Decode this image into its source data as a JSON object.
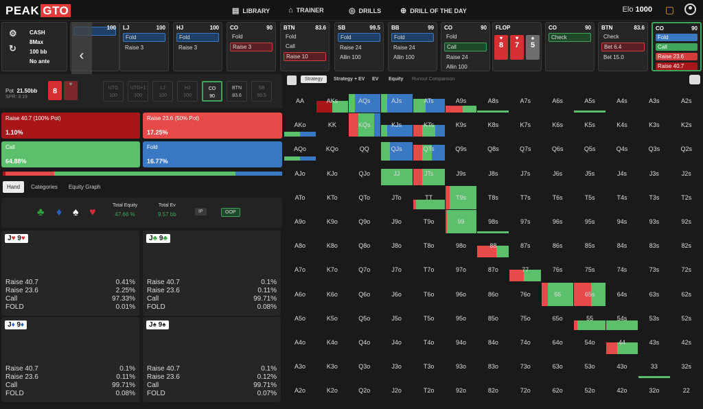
{
  "app": {
    "logo_a": "PEAK",
    "logo_b": "GTO",
    "nav": [
      "LIBRARY",
      "TRAINER",
      "DRILLS",
      "DRILL OF THE DAY"
    ],
    "elo_label": "Elo",
    "elo_value": "1000"
  },
  "info": {
    "type": "CASH",
    "format": "8Max",
    "stack": "100 bb",
    "ante": "No ante"
  },
  "strip": [
    {
      "pos": "",
      "stack": "100",
      "actions": [
        {
          "t": "",
          "s": "sel-blue"
        }
      ]
    },
    {
      "pos": "LJ",
      "stack": "100",
      "actions": [
        {
          "t": "Fold",
          "s": "sel-blue"
        },
        {
          "t": "Raise 3",
          "s": ""
        }
      ]
    },
    {
      "pos": "HJ",
      "stack": "100",
      "actions": [
        {
          "t": "Fold",
          "s": "sel-blue"
        },
        {
          "t": "Raise 3",
          "s": ""
        }
      ]
    },
    {
      "pos": "CO",
      "stack": "90",
      "actions": [
        {
          "t": "Fold",
          "s": ""
        },
        {
          "t": "Raise 3",
          "s": "sel-red"
        }
      ]
    },
    {
      "pos": "BTN",
      "stack": "83.6",
      "actions": [
        {
          "t": "Fold",
          "s": ""
        },
        {
          "t": "Call",
          "s": ""
        },
        {
          "t": "Raise 10",
          "s": "sel-red"
        }
      ]
    },
    {
      "pos": "SB",
      "stack": "99.5",
      "actions": [
        {
          "t": "Fold",
          "s": "sel-blue"
        },
        {
          "t": "Raise 24",
          "s": ""
        },
        {
          "t": "Allin 100",
          "s": ""
        }
      ]
    },
    {
      "pos": "BB",
      "stack": "99",
      "actions": [
        {
          "t": "Fold",
          "s": "sel-blue"
        },
        {
          "t": "Raise 24",
          "s": ""
        },
        {
          "t": "Allin 100",
          "s": ""
        }
      ]
    },
    {
      "pos": "CO",
      "stack": "90",
      "actions": [
        {
          "t": "Fold",
          "s": ""
        },
        {
          "t": "Call",
          "s": "sel-green"
        },
        {
          "t": "Raise 24",
          "s": ""
        },
        {
          "t": "Allin 100",
          "s": ""
        }
      ]
    }
  ],
  "flop": {
    "label": "FLOP",
    "cards": [
      {
        "r": "8",
        "s": "♥",
        "c": "red"
      },
      {
        "r": "7",
        "s": "♥",
        "c": "red"
      },
      {
        "r": "5",
        "s": "♠",
        "c": "grey"
      }
    ]
  },
  "strip2": [
    {
      "pos": "CO",
      "stack": "90",
      "actions": [
        {
          "t": "Check",
          "s": "sel-green"
        }
      ]
    },
    {
      "pos": "BTN",
      "stack": "83.6",
      "actions": [
        {
          "t": "Check",
          "s": ""
        },
        {
          "t": "Bet 6.4",
          "s": "sel-red"
        },
        {
          "t": "Bet 15.0",
          "s": ""
        }
      ]
    }
  ],
  "active": {
    "pos": "CO",
    "stack": "90",
    "actions": [
      {
        "t": "Fold",
        "s": "fill-blue"
      },
      {
        "t": "Call",
        "s": "fill-green"
      },
      {
        "t": "Raise 23.6",
        "s": "fill-red"
      },
      {
        "t": "Raise 40.7",
        "s": "fill-dred"
      }
    ]
  },
  "pot": {
    "label": "Pot",
    "value": "21.50bb",
    "spr": "SPR: 3.19",
    "card": "8"
  },
  "seats": [
    {
      "n": "UTG",
      "v": "100",
      "st": ""
    },
    {
      "n": "UTG+1",
      "v": "100",
      "st": ""
    },
    {
      "n": "LJ",
      "v": "100",
      "st": ""
    },
    {
      "n": "HJ",
      "v": "100",
      "st": ""
    },
    {
      "n": "CO",
      "v": "90",
      "st": "on"
    },
    {
      "n": "BTN",
      "v": "83.6",
      "st": "lit"
    },
    {
      "n": "SB",
      "v": "99.5",
      "st": ""
    }
  ],
  "strategy": [
    {
      "label": "Raise 40.7 (100% Pot)",
      "pct": "1.10%",
      "color": "#a8161a"
    },
    {
      "label": "Raise 23.6 (50% Pot)",
      "pct": "17.25%",
      "color": "#e84a4a"
    },
    {
      "label": "Call",
      "pct": "64.88%",
      "color": "#5cbf6b"
    },
    {
      "label": "Fold",
      "pct": "16.77%",
      "color": "#3b78c4"
    }
  ],
  "freq_bar": [
    {
      "f": 1.1,
      "color": "#a8161a"
    },
    {
      "f": 17.25,
      "color": "#e84a4a"
    },
    {
      "f": 64.88,
      "color": "#5cbf6b"
    },
    {
      "f": 16.77,
      "color": "#3b78c4"
    }
  ],
  "tabs": [
    "Hand",
    "Categories",
    "Equity Graph"
  ],
  "totals": {
    "eq_label": "Total Equity",
    "eq": "47.66 %",
    "ev_label": "Total Ev",
    "ev": "9.57 bb",
    "ip": "IP",
    "oop": "OOP"
  },
  "hands": [
    {
      "rank1": "J",
      "suit1": "♥",
      "rank2": "9",
      "suit2": "♥",
      "color": "#d62f33",
      "rows": [
        [
          "Raise 40.7",
          "0.41%"
        ],
        [
          "Raise 23.6",
          "2.25%"
        ],
        [
          "Call",
          "97.33%"
        ],
        [
          "FOLD",
          "0.01%"
        ]
      ]
    },
    {
      "rank1": "J",
      "suit1": "♣",
      "rank2": "9",
      "suit2": "♣",
      "color": "#2e9e3e",
      "rows": [
        [
          "Raise 40.7",
          "0.1%"
        ],
        [
          "Raise 23.6",
          "0.11%"
        ],
        [
          "Call",
          "99.71%"
        ],
        [
          "FOLD",
          "0.08%"
        ]
      ]
    },
    {
      "rank1": "J",
      "suit1": "♦",
      "rank2": "9",
      "suit2": "♦",
      "color": "#2b5fc4",
      "rows": [
        [
          "Raise 40.7",
          "0.1%"
        ],
        [
          "Raise 23.6",
          "0.11%"
        ],
        [
          "Call",
          "99.71%"
        ],
        [
          "FOLD",
          "0.08%"
        ]
      ]
    },
    {
      "rank1": "J",
      "suit1": "♠",
      "rank2": "9",
      "suit2": "♠",
      "color": "#222222",
      "rows": [
        [
          "Raise 40.7",
          "0.1%"
        ],
        [
          "Raise 23.6",
          "0.12%"
        ],
        [
          "Call",
          "99.71%"
        ],
        [
          "FOLD",
          "0.07%"
        ]
      ]
    }
  ],
  "grid_tabs": [
    "Strategy",
    "Strategy + EV",
    "EV",
    "Equity",
    "Runout Comparison"
  ],
  "ranks": [
    "A",
    "K",
    "Q",
    "J",
    "T",
    "9",
    "8",
    "7",
    "6",
    "5",
    "4",
    "3",
    "2"
  ],
  "highlights": {
    "0,1": [
      0.5,
      0.0,
      0.5,
      0.5
    ],
    "0,2": [
      0,
      0,
      0.2,
      0.8
    ],
    "0,3": [
      0,
      0,
      0.2,
      0.8
    ],
    "0,4": [
      0,
      0,
      0.4,
      0.6
    ],
    "0,5": [
      0,
      0.55,
      0.45,
      0.3
    ],
    "0,6": [
      0,
      0,
      1,
      0.1
    ],
    "0,9": [
      0,
      0,
      1,
      0.1
    ],
    "1,0": [
      0,
      0,
      0.5,
      0.2
    ],
    "1,2": [
      0,
      0.3,
      0.5,
      1
    ],
    "1,3": [
      0,
      0,
      0.2,
      0.5
    ],
    "1,4": [
      0,
      0.3,
      0.4,
      0.5
    ],
    "2,0": [
      0,
      0,
      0.5,
      0.2
    ],
    "2,3": [
      0,
      0,
      0.3,
      0.8
    ],
    "2,4": [
      0,
      0.3,
      0.3,
      0.7
    ],
    "3,3": [
      0,
      0,
      1,
      0.7
    ],
    "3,4": [
      0,
      0.3,
      0.7,
      0.7
    ],
    "4,4": [
      0,
      0.1,
      0.9,
      0.4
    ],
    "4,5": [
      0,
      0.15,
      0.85,
      1
    ],
    "5,5": [
      0,
      0.05,
      0.95,
      1
    ],
    "5,6": [
      0,
      0,
      1,
      0.1
    ],
    "6,6": [
      0,
      0.6,
      0.4,
      0.5
    ],
    "7,7": [
      0,
      0.45,
      0.55,
      0.5
    ],
    "8,8": [
      0,
      0.2,
      0.8,
      1
    ],
    "8,9": [
      0,
      0.55,
      0.45,
      1
    ],
    "9,9": [
      0,
      0.1,
      0.9,
      0.4
    ],
    "9,10": [
      0,
      0,
      1,
      0.4
    ],
    "10,10": [
      0,
      0.35,
      0.65,
      0.5
    ],
    "11,11": [
      0,
      0,
      1,
      0.1
    ]
  }
}
